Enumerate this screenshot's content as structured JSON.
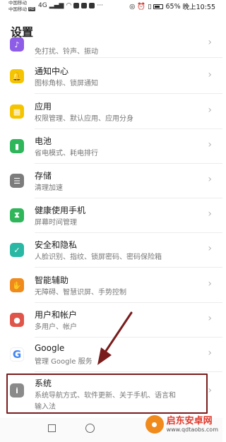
{
  "status_bar": {
    "carrier_1": "中国移动",
    "carrier_2": "中国移动",
    "hd_badge": "HD",
    "signal_text": "4G",
    "battery_percent": "65%",
    "time": "晚上10:55"
  },
  "page_title": "设置",
  "settings_items": [
    {
      "title": "",
      "subtitle": "免打扰、铃声、振动",
      "icon": "sound-icon",
      "color": "#8e5de8"
    },
    {
      "title": "通知中心",
      "subtitle": "图标角标、锁屏通知",
      "icon": "bell-icon",
      "color": "#f5c400"
    },
    {
      "title": "应用",
      "subtitle": "权限管理、默认应用、应用分身",
      "icon": "apps-icon",
      "color": "#f5c400"
    },
    {
      "title": "电池",
      "subtitle": "省电模式、耗电排行",
      "icon": "battery-icon",
      "color": "#2fb55a"
    },
    {
      "title": "存储",
      "subtitle": "清理加速",
      "icon": "storage-icon",
      "color": "#7c7c7c"
    },
    {
      "title": "健康使用手机",
      "subtitle": "屏幕时间管理",
      "icon": "hourglass-icon",
      "color": "#2fb55a"
    },
    {
      "title": "安全和隐私",
      "subtitle": "人脸识别、指纹、锁屏密码、密码保险箱",
      "icon": "shield-icon",
      "color": "#2ab8a4"
    },
    {
      "title": "智能辅助",
      "subtitle": "无障碍、智慧识屏、手势控制",
      "icon": "hand-icon",
      "color": "#f08a1c"
    },
    {
      "title": "用户和帐户",
      "subtitle": "多用户、帐户",
      "icon": "user-icon",
      "color": "#e0554a"
    },
    {
      "title": "Google",
      "subtitle": "管理 Google 服务",
      "icon": "google-icon",
      "color": "#ffffff"
    },
    {
      "title": "系统",
      "subtitle": "系统导航方式、软件更新、关于手机、语言和",
      "subtitle_line2": "输入法",
      "icon": "info-icon",
      "color": "#8a8a8a"
    }
  ],
  "chevron": "›",
  "watermark": {
    "name": "启东安卓网",
    "url": "www.qdtaobs.com"
  },
  "colors": {
    "highlight": "#7a1c1c",
    "arrow": "#7a1c1c"
  }
}
